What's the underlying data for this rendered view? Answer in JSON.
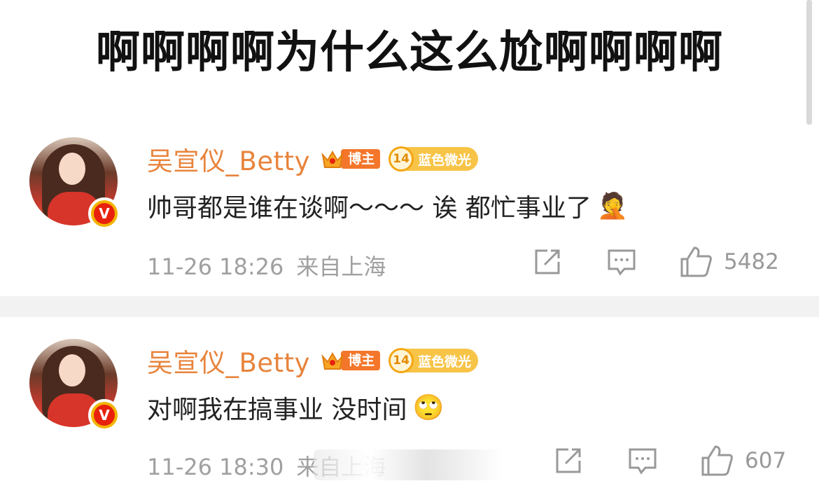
{
  "headline": "啊啊啊啊为什么这么尬啊啊啊啊",
  "colors": {
    "username": "#e8843c",
    "blogger_badge": "#f3762a",
    "level_badge": "#f7c447",
    "meta": "#a0a0a0"
  },
  "comments": [
    {
      "user": {
        "name": "吴宣仪_Betty",
        "verified_mark": "V",
        "badges": {
          "blogger": "博主",
          "level": "14",
          "level_label": "蓝色微光"
        }
      },
      "text": "帅哥都是谁在谈啊～～～ 诶 都忙事业了",
      "emoji": "🤦",
      "emoji_name": "facepalm-emoji",
      "time": "11-26 18:26",
      "location": "来自上海",
      "likes": "5482"
    },
    {
      "user": {
        "name": "吴宣仪_Betty",
        "verified_mark": "V",
        "badges": {
          "blogger": "博主",
          "level": "14",
          "level_label": "蓝色微光"
        }
      },
      "text": "对啊我在搞事业 没时间",
      "emoji": "🙄",
      "emoji_name": "eye-roll-emoji",
      "time": "11-26 18:30",
      "location": "来自上海",
      "likes": "607"
    }
  ],
  "icons": [
    "share-icon",
    "comment-icon",
    "like-icon",
    "crown-icon",
    "verified-icon"
  ]
}
